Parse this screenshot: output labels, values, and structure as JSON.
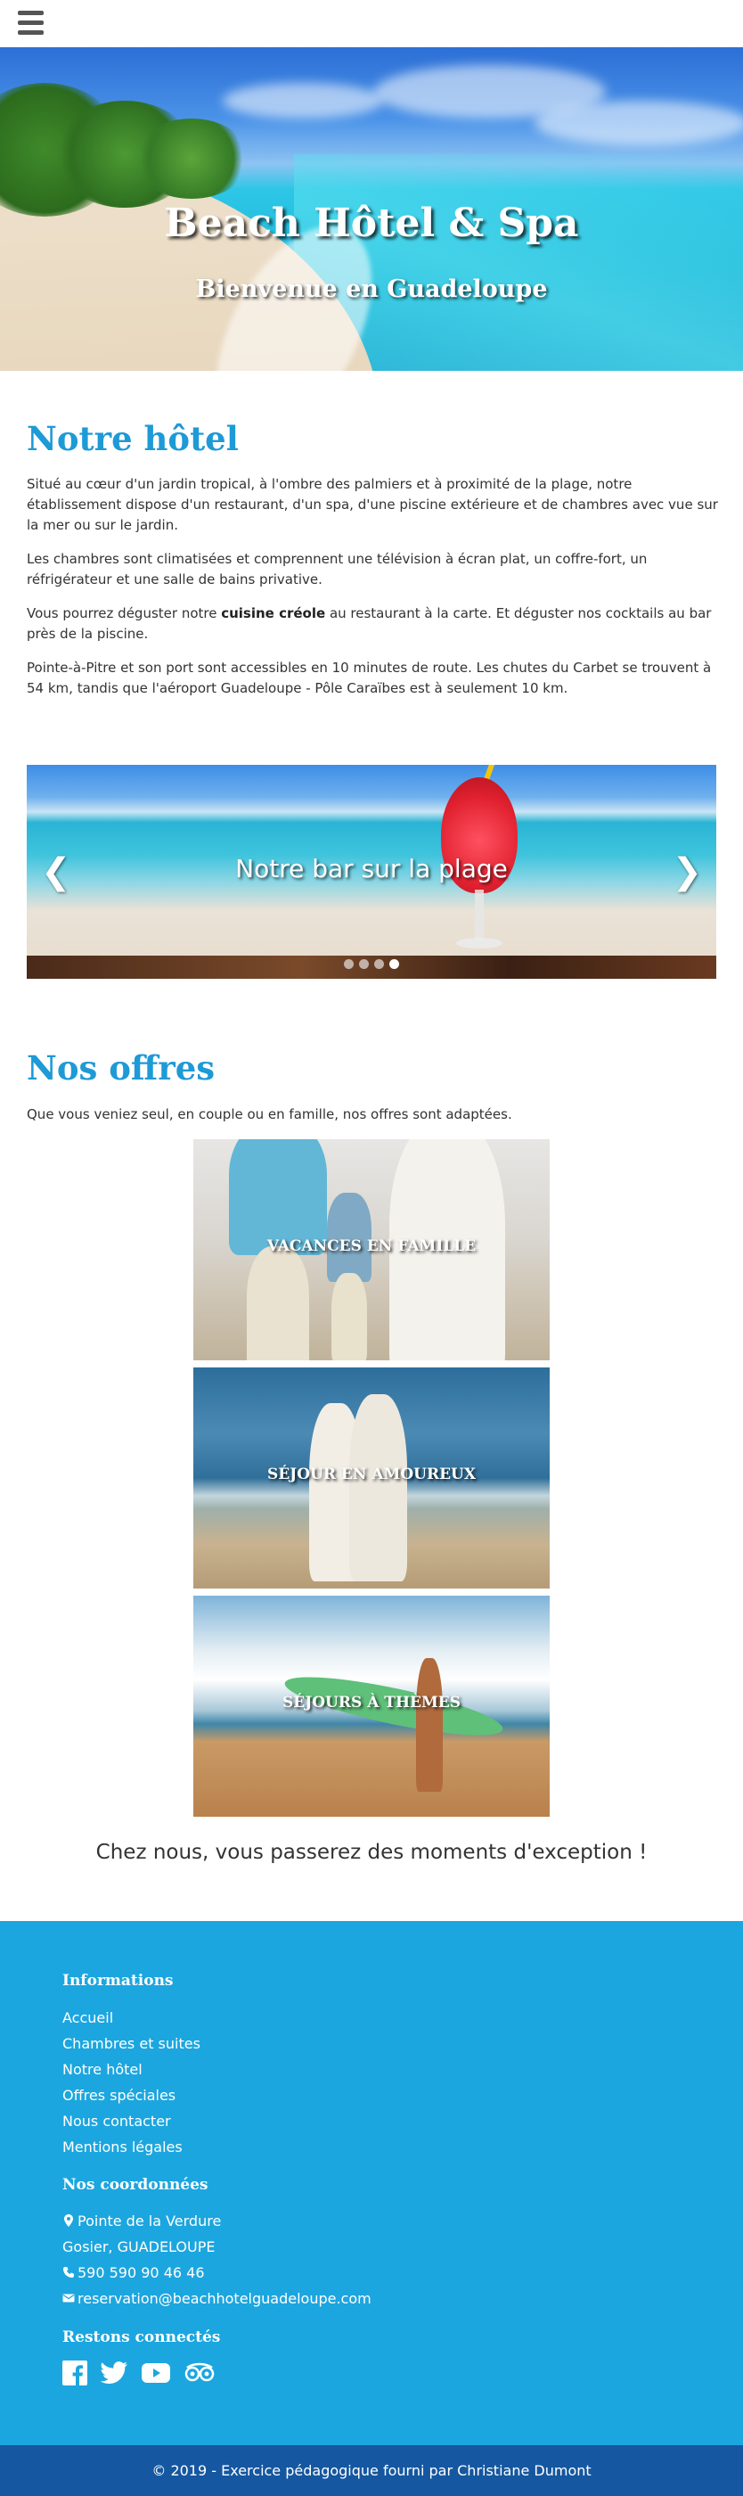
{
  "hero": {
    "title": "Beach Hôtel & Spa",
    "subtitle": "Bienvenue en Guadeloupe"
  },
  "hotel": {
    "heading": "Notre hôtel",
    "p1": "Situé au cœur d'un jardin tropical, à l'ombre des palmiers et à proximité de la plage, notre établissement dispose d'un restaurant, d'un spa, d'une piscine extérieure et de chambres avec vue sur la mer ou sur le jardin.",
    "p2": "Les chambres sont climatisées et comprennent une télévision à écran plat, un coffre-fort, un réfrigérateur et une salle de bains privative.",
    "p3_before": "Vous pourrez déguster notre ",
    "p3_bold": "cuisine créole",
    "p3_after": " au restaurant à la carte. Et déguster nos cocktails au bar près de la piscine.",
    "p4": "Pointe-à-Pitre et son port sont accessibles en 10 minutes de route. Les chutes du Carbet se trouvent à 54 km, tandis que l'aéroport Guadeloupe - Pôle Caraïbes est à seulement 10 km."
  },
  "carousel": {
    "caption": "Notre bar sur la plage",
    "prev_icon": "chevron-left-icon",
    "next_icon": "chevron-right-icon",
    "active_slide": 3,
    "slide_count": 4
  },
  "offers": {
    "heading": "Nos offres",
    "intro": "Que vous veniez seul, en couple ou en famille, nos offres sont adaptées.",
    "items": [
      {
        "label": "VACANCES EN FAMILLE"
      },
      {
        "label": "SÉJOUR EN AMOUREUX"
      },
      {
        "label": "SÉJOURS À THÈMES"
      }
    ],
    "tagline": "Chez nous, vous passerez des moments d'exception !"
  },
  "footer": {
    "info_heading": "Informations",
    "links": [
      "Accueil",
      "Chambres et suites",
      "Notre hôtel",
      "Offres spéciales",
      "Nous contacter",
      "Mentions légales"
    ],
    "contact_heading": "Nos coordonnées",
    "address1": "Pointe de la Verdure",
    "address2": "Gosier, GUADELOUPE",
    "phone": "590 590 90 46 46",
    "email": "reservation@beachhotelguadeloupe.com",
    "social_heading": "Restons connectés",
    "social": [
      "facebook-icon",
      "twitter-icon",
      "youtube-icon",
      "tripadvisor-icon"
    ],
    "copyright": "© 2019 - Exercice pédagogique fourni par Christiane Dumont"
  },
  "colors": {
    "accent": "#1e9ad6",
    "footer_bg": "#1ca6df",
    "copyright_bg": "#1557a0"
  }
}
